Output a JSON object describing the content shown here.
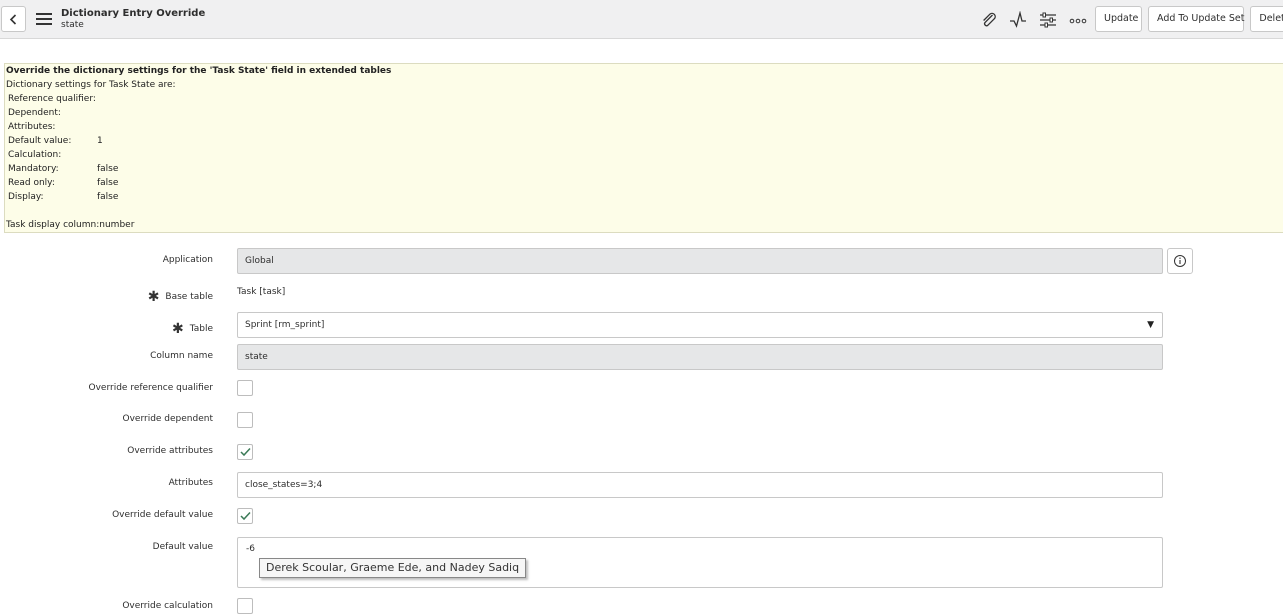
{
  "header": {
    "title": "Dictionary Entry Override",
    "subtitle": "state",
    "buttons": {
      "update": "Update",
      "add_to_update_set": "Add To Update Set",
      "delete": "Delete"
    }
  },
  "info": {
    "heading": "Override the dictionary settings for the 'Task State' field in extended tables",
    "intro": "Dictionary settings for Task State are:",
    "rows": [
      {
        "label": "Reference qualifier:",
        "value": ""
      },
      {
        "label": "Dependent:",
        "value": ""
      },
      {
        "label": "Attributes:",
        "value": ""
      },
      {
        "label": "Default value:",
        "value": "1"
      },
      {
        "label": "Calculation:",
        "value": ""
      },
      {
        "label": "Mandatory:",
        "value": "false"
      },
      {
        "label": "Read only:",
        "value": "false"
      },
      {
        "label": "Display:",
        "value": "false"
      }
    ],
    "footer": "Task display column:number"
  },
  "form": {
    "application": {
      "label": "Application",
      "value": "Global"
    },
    "base_table": {
      "label": "Base table",
      "value": "Task [task]",
      "required": "✱"
    },
    "table": {
      "label": "Table",
      "value": "Sprint [rm_sprint]",
      "required": "✱",
      "caret": "▼"
    },
    "column_name": {
      "label": "Column name",
      "value": "state"
    },
    "override_reference_qualifier": {
      "label": "Override reference qualifier",
      "checked": false
    },
    "override_dependent": {
      "label": "Override dependent",
      "checked": false
    },
    "override_attributes": {
      "label": "Override attributes",
      "checked": true
    },
    "attributes": {
      "label": "Attributes",
      "value": "close_states=3;4"
    },
    "override_default_value": {
      "label": "Override default value",
      "checked": true
    },
    "default_value": {
      "label": "Default value",
      "value": "-6"
    },
    "override_calculation": {
      "label": "Override calculation",
      "checked": false
    }
  },
  "tooltip": {
    "text": "Derek Scoular, Graeme Ede, and Nadey Sadiq"
  },
  "icons": [
    "chevron-left-icon",
    "hamburger-menu-icon",
    "paperclip-icon",
    "activity-icon",
    "sliders-icon",
    "more-options-icon",
    "info-icon",
    "checkmark-icon"
  ]
}
